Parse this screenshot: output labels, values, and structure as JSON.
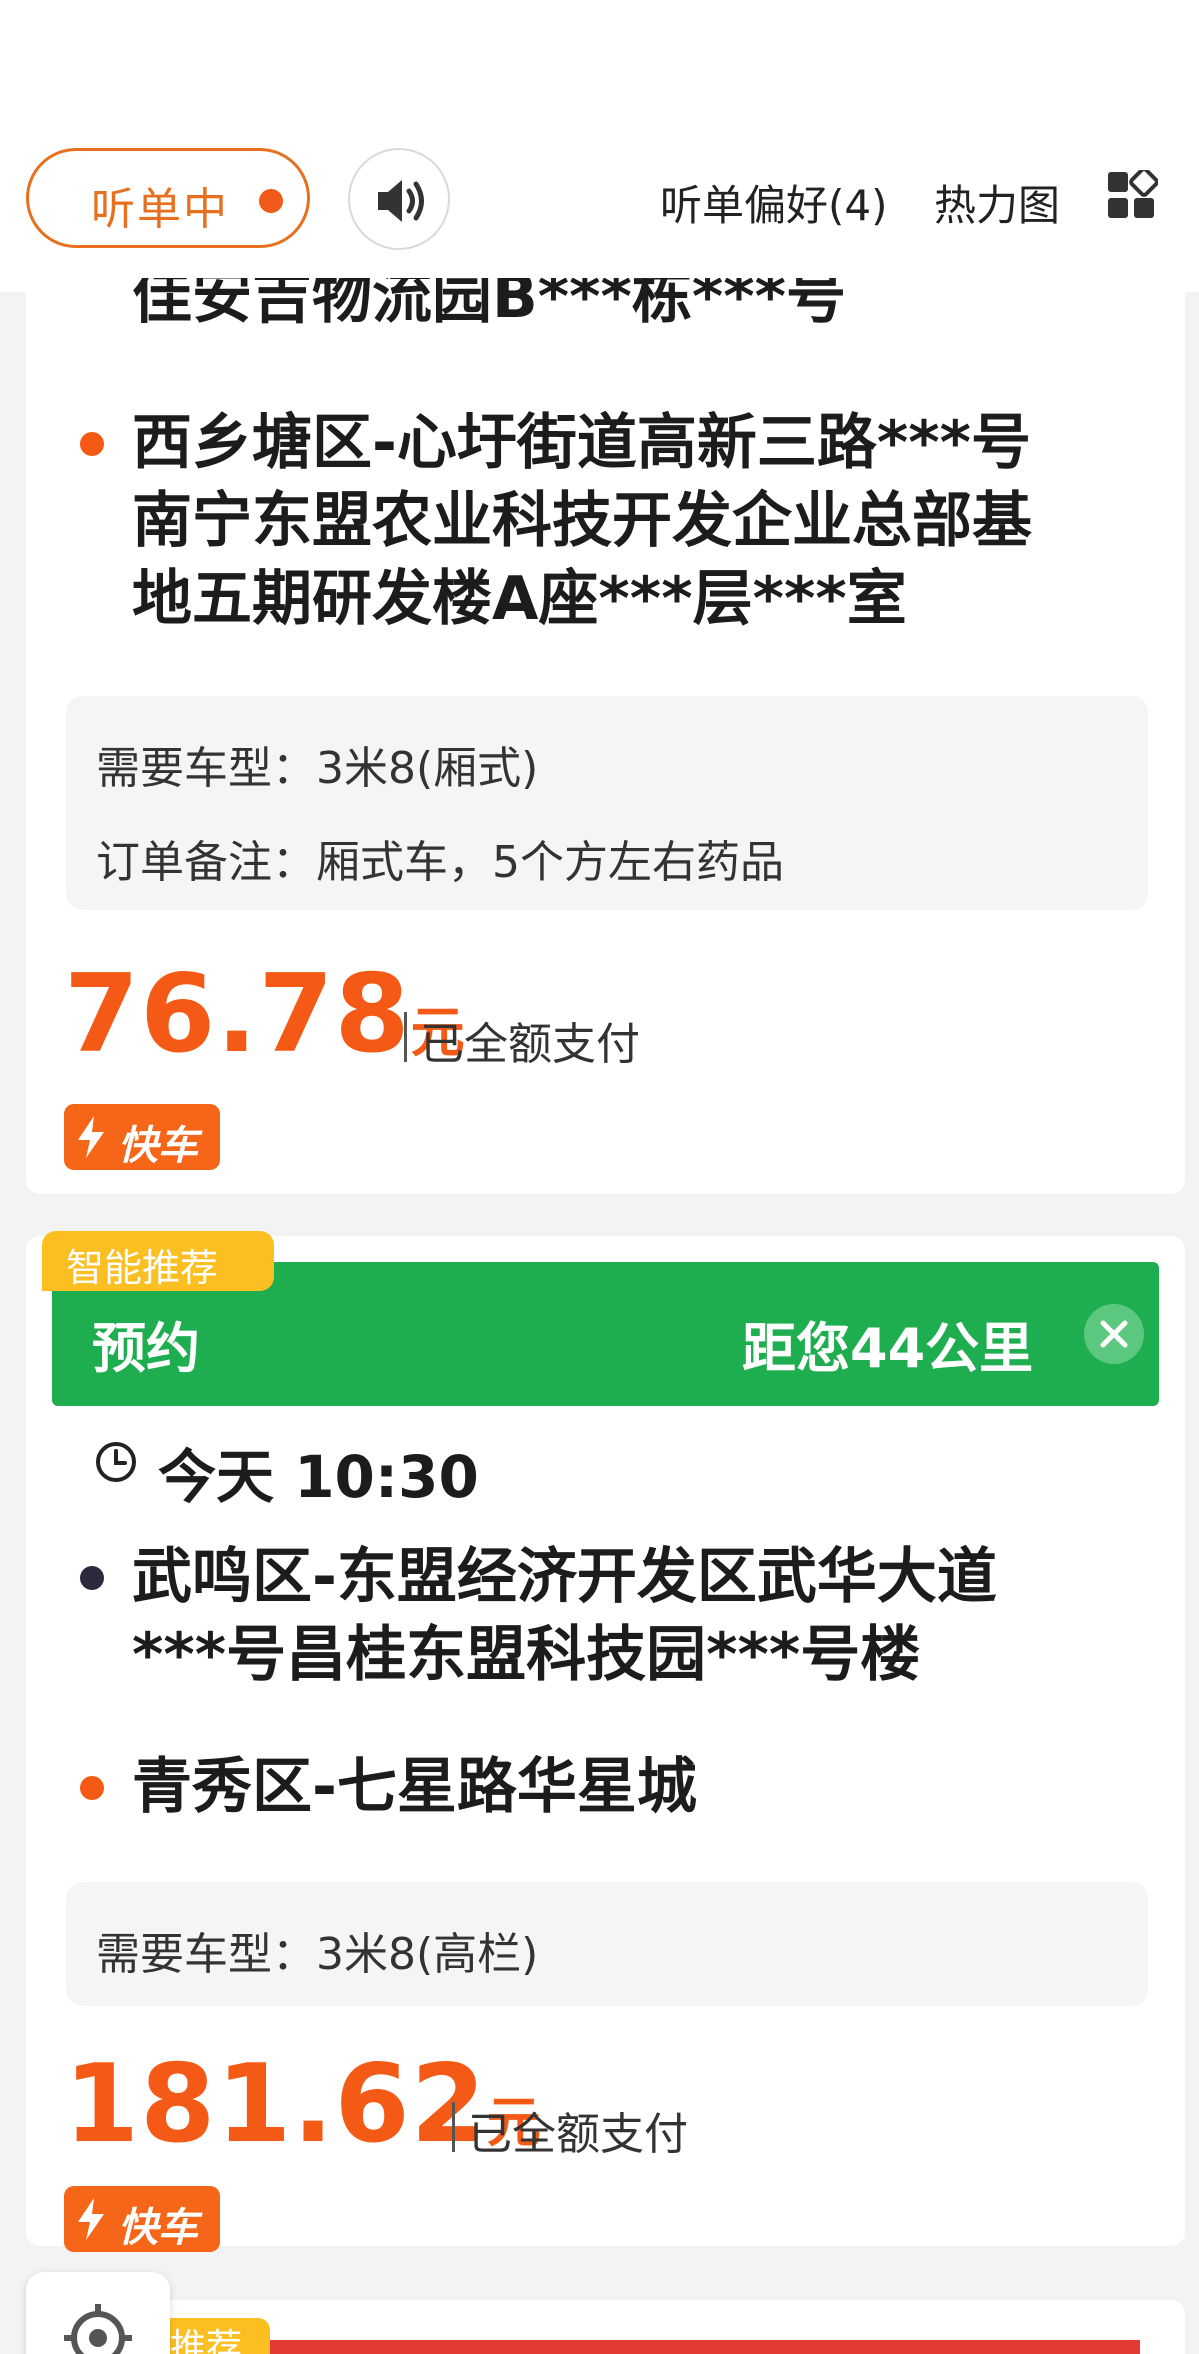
{
  "header": {
    "listen_label": "听单中",
    "prefs_label": "听单偏好(4)",
    "heatmap_label": "热力图",
    "colors": {
      "accent": "#e6701f",
      "dot": "#f05a1a"
    }
  },
  "order1": {
    "pickup_partial": "佳安吉物流园B***栋***号",
    "dropoff_lines": [
      "西乡塘区-心圩街道高新三路***号",
      "南宁东盟农业科技开发企业总部基",
      "地五期研发楼A座***层***室"
    ],
    "vehicle_label": "需要车型：3米8(厢式)",
    "note_label": "订单备注：厢式车，5个方左右药品",
    "price": "76.78",
    "price_unit": "元",
    "paid_label": "已全额支付",
    "badge": "快车"
  },
  "order2": {
    "smart_tag": "智能推荐",
    "type_label": "预约",
    "distance_label": "距您44公里",
    "time_label": "今天 10:30",
    "pickup_lines": [
      "武鸣区-东盟经济开发区武华大道",
      "***号昌桂东盟科技园***号楼"
    ],
    "dropoff_lines": [
      "青秀区-七星路华星城"
    ],
    "vehicle_label": "需要车型：3米8(高栏)",
    "price": "181.62",
    "price_unit": "元",
    "paid_label": "已全额支付",
    "badge": "快车",
    "colors": {
      "banner": "#1fae4f",
      "tag": "#fbbf22"
    }
  },
  "order3": {
    "smart_tag_partial": "推荐"
  }
}
